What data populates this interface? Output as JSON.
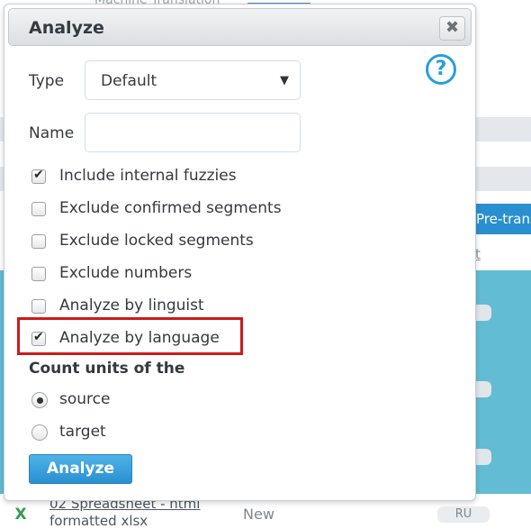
{
  "background": {
    "top_text": "Machine Translation",
    "pretranslate_label": "Pre-translate",
    "link_fragment": "t",
    "file_icon": "X",
    "file_name_line1": "02 Spreadsheet - html",
    "file_name_line2": "formatted xlsx",
    "status": "New",
    "language": "RU"
  },
  "dialog": {
    "title": "Analyze",
    "close_icon": "close-icon",
    "close_glyph": "✖",
    "help_icon": "help-icon",
    "help_glyph": "?",
    "type_label": "Type",
    "type_value": "Default",
    "type_arrow": "▼",
    "name_label": "Name",
    "name_value": "",
    "name_placeholder": "",
    "checkboxes": [
      {
        "label": "Include internal fuzzies",
        "checked": true
      },
      {
        "label": "Exclude confirmed segments",
        "checked": false
      },
      {
        "label": "Exclude locked segments",
        "checked": false
      },
      {
        "label": "Exclude numbers",
        "checked": false
      },
      {
        "label": "Analyze by linguist",
        "checked": false
      },
      {
        "label": "Analyze by language",
        "checked": true
      }
    ],
    "count_units_label": "Count units of the",
    "radios": [
      {
        "label": "source",
        "checked": true
      },
      {
        "label": "target",
        "checked": false
      }
    ],
    "analyze_button": "Analyze"
  },
  "colors": {
    "accent": "#2a8fd0",
    "highlight": "#cc1a1a",
    "background_blue": "#62bcd4"
  }
}
